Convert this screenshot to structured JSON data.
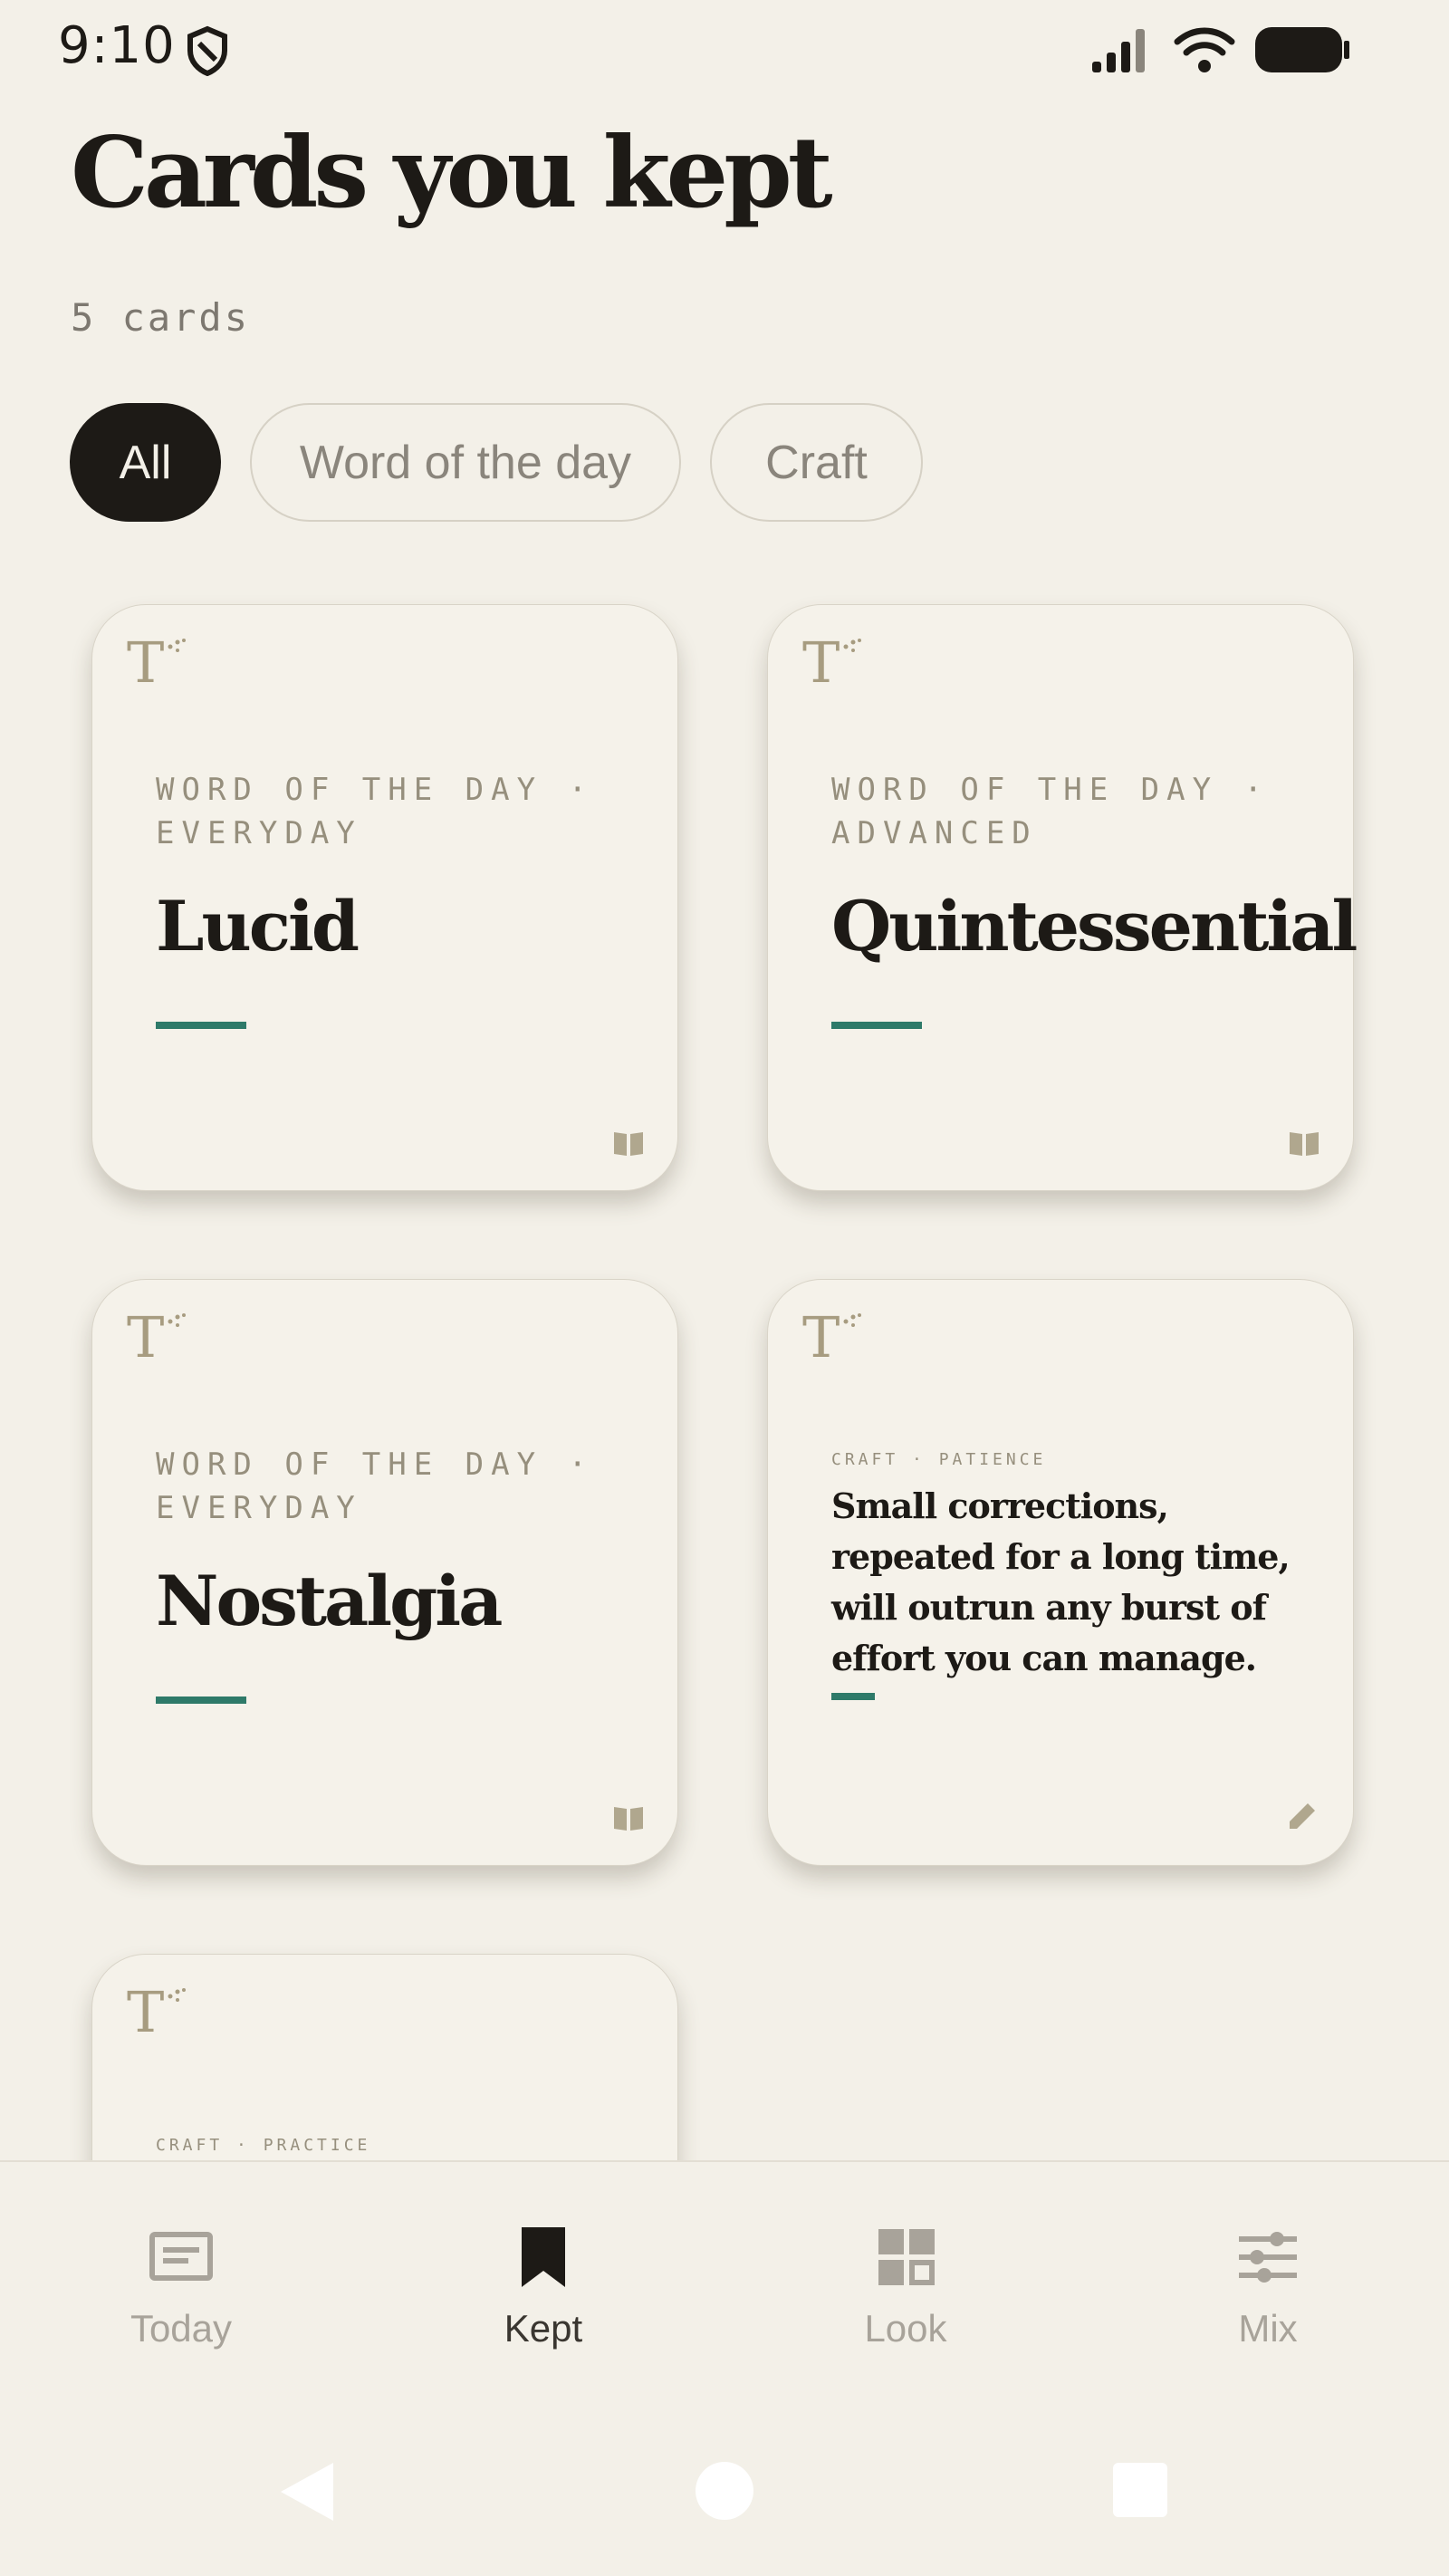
{
  "status": {
    "time": "9:10"
  },
  "header": {
    "title": "Cards you kept",
    "count": "5 cards"
  },
  "filters": [
    {
      "label": "All",
      "active": true
    },
    {
      "label": "Word of the day",
      "active": false
    },
    {
      "label": "Craft",
      "active": false
    }
  ],
  "cards": [
    {
      "kicker": "WORD OF THE DAY · EVERYDAY",
      "word": "Lucid"
    },
    {
      "kicker": "WORD OF THE DAY · ADVANCED",
      "word": "Quintessential"
    },
    {
      "kicker": "WORD OF THE DAY · EVERYDAY",
      "word": "Nostalgia"
    },
    {
      "kicker": "CRAFT · PATIENCE",
      "quote": "Small corrections, repeated for a long time, will outrun any burst of effort you can manage."
    },
    {
      "kicker": "CRAFT · PRACTICE"
    }
  ],
  "nav": [
    {
      "label": "Today",
      "icon": "today-card-icon",
      "active": false
    },
    {
      "label": "Kept",
      "icon": "bookmark-icon",
      "active": true
    },
    {
      "label": "Look",
      "icon": "grid-icon",
      "active": false
    },
    {
      "label": "Mix",
      "icon": "sliders-icon",
      "active": false
    }
  ],
  "colors": {
    "accent": "#2e7a69",
    "ink": "#1d1a16",
    "background": "#f3f0e8",
    "card": "#f5f2ea"
  }
}
